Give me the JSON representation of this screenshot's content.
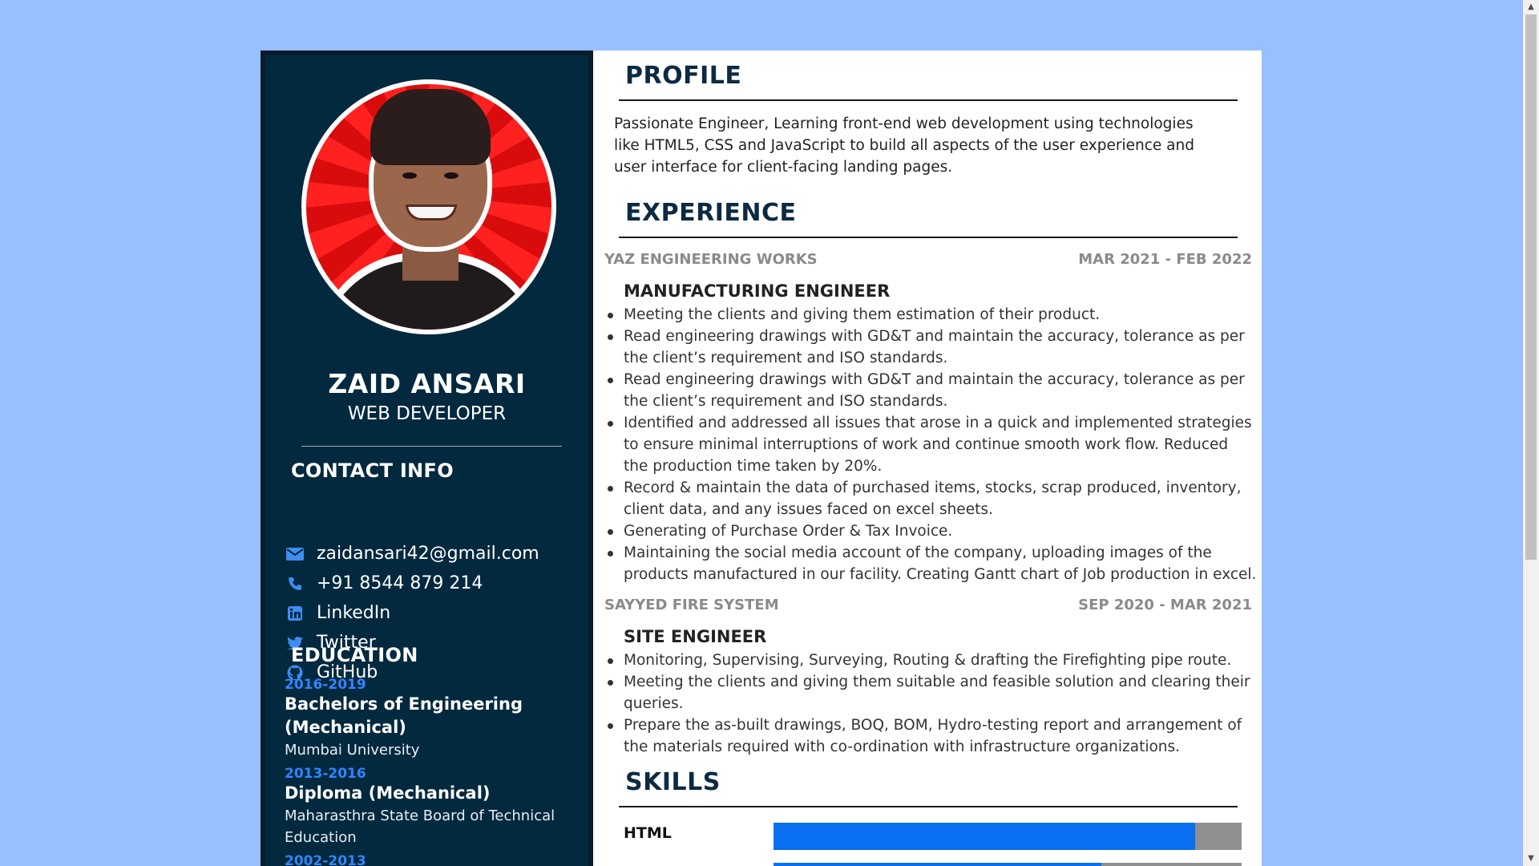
{
  "colors": {
    "page_background": "#99c0fe",
    "sidebar": "#03293f",
    "accent": "#2f86ff",
    "skill_bar_fill": "#0a6ff0",
    "skill_bar_track": "#8f8f8f"
  },
  "sidebar": {
    "name": "ZAID ANSARI",
    "role": "WEB DEVELOPER",
    "contact_heading": "CONTACT INFO",
    "contacts": [
      {
        "icon": "envelope-icon",
        "label": "zaidansari42@gmail.com"
      },
      {
        "icon": "phone-icon",
        "label": "+91 8544 879 214"
      },
      {
        "icon": "linkedin-icon",
        "label": "LinkedIn"
      },
      {
        "icon": "twitter-icon",
        "label": "Twitter"
      },
      {
        "icon": "github-icon",
        "label": "GitHub"
      }
    ],
    "education_heading": "EDUCATION",
    "education": [
      {
        "years": "2016-2019",
        "degree": "Bachelors of Engineering (Mechanical)",
        "school": "Mumbai University"
      },
      {
        "years": "2013-2016",
        "degree": "Diploma (Mechanical)",
        "school": "Maharasthra State Board of Technical Education"
      },
      {
        "years": "2002-2013",
        "degree": "",
        "school": ""
      }
    ]
  },
  "main": {
    "profile_heading": "PROFILE",
    "profile_text": "Passionate Engineer, Learning front-end web development using technologies like HTML5, CSS and JavaScript to build all aspects of the user experience and user interface for client-facing landing pages.",
    "experience_heading": "EXPERIENCE",
    "jobs": [
      {
        "company": "YAZ ENGINEERING WORKS",
        "dates": "MAR 2021 - FEB 2022",
        "title": "MANUFACTURING ENGINEER",
        "bullets": [
          "Meeting the clients and giving them estimation of their product.",
          "Read engineering drawings with GD&T and maintain the accuracy, tolerance as per the client’s requirement and ISO standards.",
          "Read engineering drawings with GD&T and maintain the accuracy, tolerance as per the client’s requirement and ISO standards.",
          "Identified and addressed all issues that arose in a quick and implemented strategies to ensure minimal interruptions of work and continue smooth work flow. Reduced the production time taken by 20%.",
          "Record & maintain the data of purchased items, stocks, scrap produced, inventory, client data, and any issues faced on excel sheets.",
          "Generating of Purchase Order & Tax Invoice.",
          "Maintaining the social media account of the company, uploading images of the products manufactured in our facility. Creating Gantt chart of Job production in excel."
        ]
      },
      {
        "company": "SAYYED FIRE SYSTEM",
        "dates": "SEP 2020 - MAR 2021",
        "title": "SITE ENGINEER",
        "bullets": [
          "Monitoring, Supervising, Surveying, Routing & drafting the Firefighting pipe route.",
          "Meeting the clients and giving them suitable and feasible solution and clearing their queries.",
          "Prepare the as-built drawings, BOQ, BOM, Hydro-testing report and arrangement of the materials required with co-ordination with infrastructure organizations."
        ]
      }
    ],
    "skills_heading": "SKILLS",
    "skills": [
      {
        "name": "HTML",
        "level": 0.9
      },
      {
        "name": "",
        "level": 0.7
      }
    ]
  }
}
